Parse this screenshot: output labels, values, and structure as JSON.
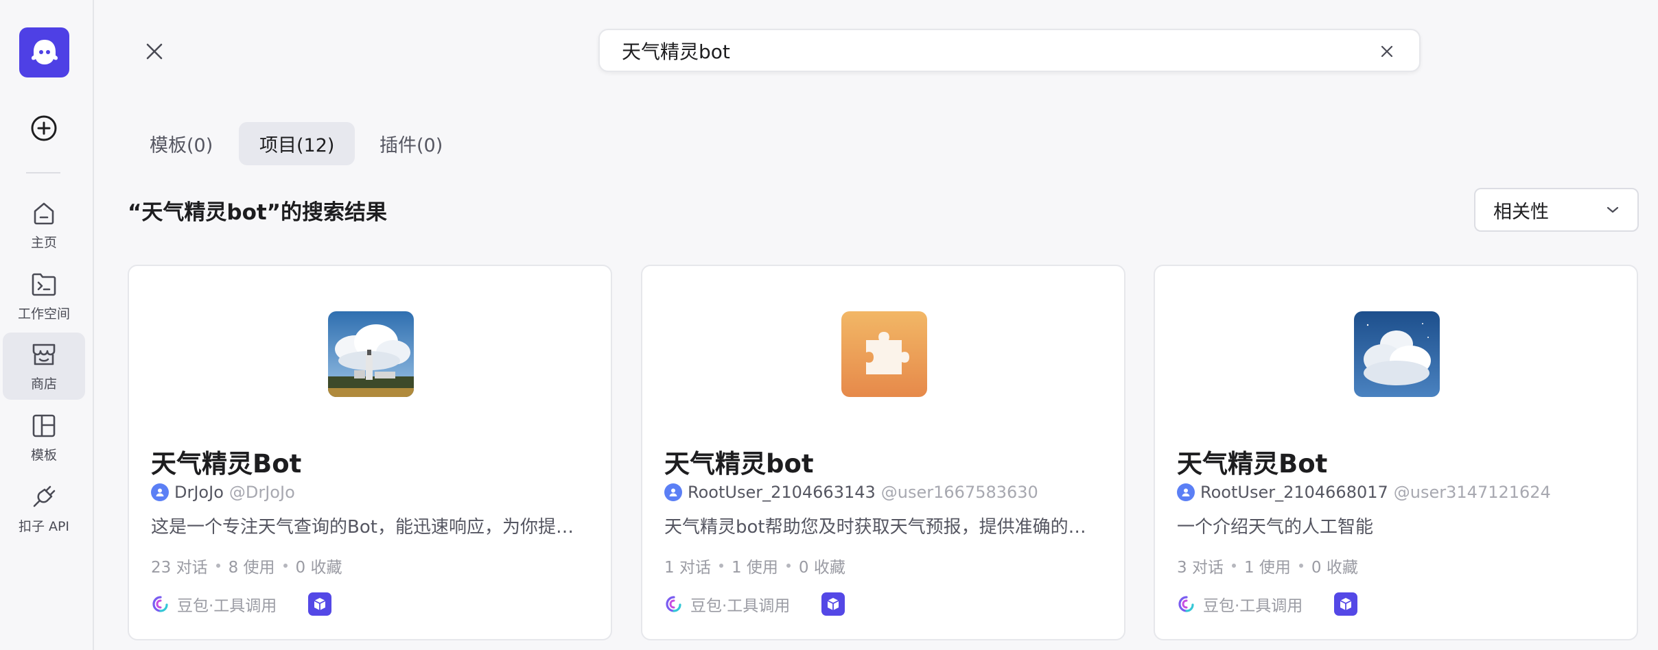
{
  "sidebar": {
    "logo_icon": "ghost-logo",
    "add_icon": "plus-circle-icon",
    "items": [
      {
        "label": "主页",
        "icon": "home-icon"
      },
      {
        "label": "工作空间",
        "icon": "terminal-folder-icon"
      },
      {
        "label": "商店",
        "icon": "store-icon",
        "active": true
      },
      {
        "label": "模板",
        "icon": "layout-icon"
      },
      {
        "label": "扣子 API",
        "icon": "plug-icon"
      }
    ]
  },
  "search": {
    "value": "天气精灵bot",
    "clear_icon": "close-icon"
  },
  "tabs": [
    {
      "label": "模板(0)"
    },
    {
      "label": "项目(12)",
      "active": true
    },
    {
      "label": "插件(0)"
    }
  ],
  "results": {
    "title": "“天气精灵bot”的搜索结果",
    "sort_label": "相关性",
    "sort_icon": "chevron-down-icon"
  },
  "cards": [
    {
      "title": "天气精灵Bot",
      "thumb": "lighthouse-cloud-photo",
      "author_name": "DrJoJo",
      "author_handle": "@DrJoJo",
      "description": "这是一个专注天气查询的Bot，能迅速响应，为你提供准确的天气信息",
      "stats": [
        "23 对话",
        "8 使用",
        "0 收藏"
      ],
      "model_label": "豆包·工具调用"
    },
    {
      "title": "天气精灵bot",
      "thumb": "puzzle-piece-icon",
      "author_name": "RootUser_2104663143",
      "author_handle": "@user1667583630",
      "description": "天气精灵bot帮助您及时获取天气预报，提供准确的天气信息",
      "stats": [
        "1 对话",
        "1 使用",
        "0 收藏"
      ],
      "model_label": "豆包·工具调用"
    },
    {
      "title": "天气精灵Bot",
      "thumb": "cumulus-cloud-photo",
      "author_name": "RootUser_2104668017",
      "author_handle": "@user3147121624",
      "description": "一个介绍天气的人工智能",
      "stats": [
        "3 对话",
        "1 使用",
        "0 收藏"
      ],
      "model_label": "豆包·工具调用"
    }
  ],
  "colors": {
    "brand": "#4e40e5",
    "plugin_badge": "#5448e6",
    "avatar": "#5b7ff5",
    "puzzle_orange": "#ec9a4c"
  }
}
